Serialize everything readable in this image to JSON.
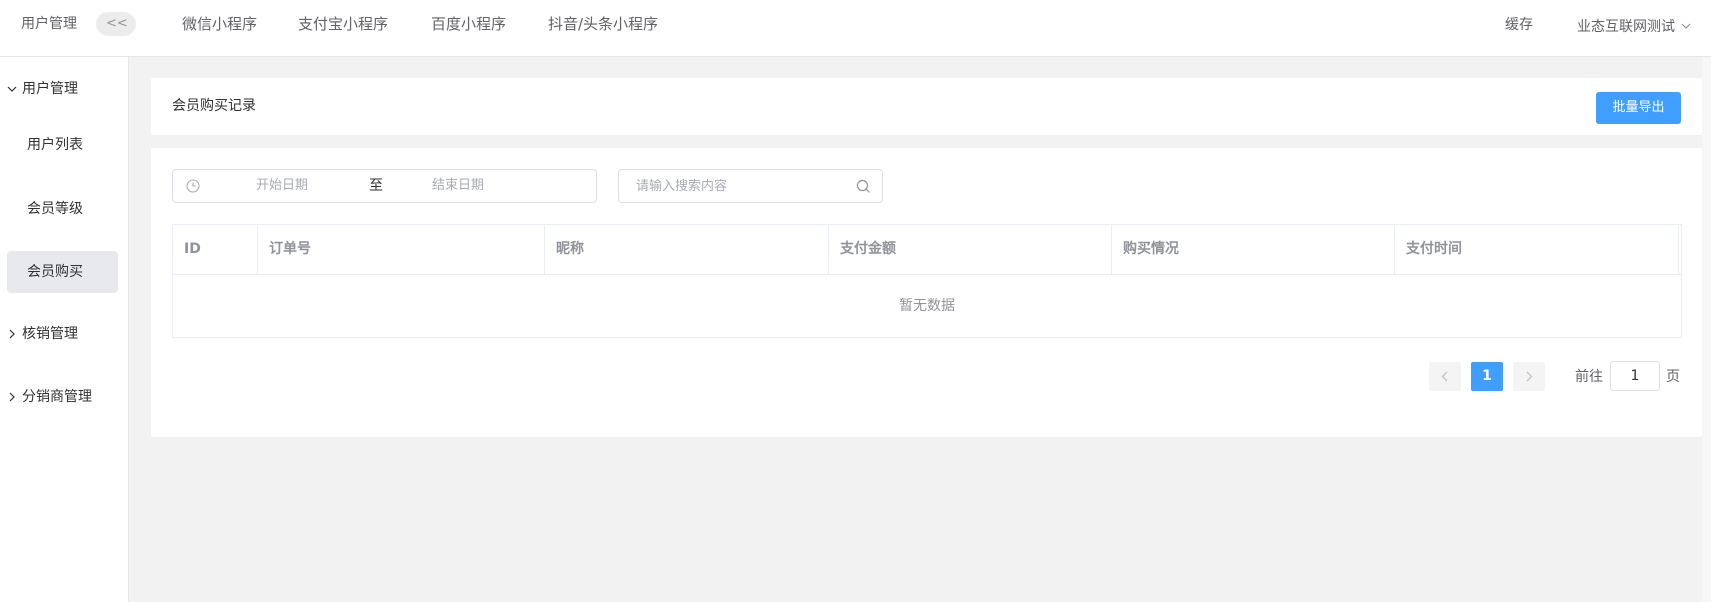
{
  "app": {
    "brand": "用户管理",
    "collapse_label": "<<"
  },
  "topnav": {
    "items": [
      "微信小程序",
      "支付宝小程序",
      "百度小程序",
      "抖音/头条小程序"
    ],
    "cache": "缓存",
    "account": "业态互联网测试",
    "account_icon": "chevron-down-icon"
  },
  "sidebar": {
    "group_user": "用户管理",
    "items": [
      "用户列表",
      "会员等级",
      "会员购买"
    ],
    "active_item": "会员购买",
    "group_verify": "核销管理",
    "group_dist": "分销商管理"
  },
  "page": {
    "title": "会员购买记录",
    "export_label": "批量导出"
  },
  "filters": {
    "start_placeholder": "开始日期",
    "range_separator": "至",
    "end_placeholder": "结束日期",
    "search_placeholder": "请输入搜索内容"
  },
  "table": {
    "columns": [
      "ID",
      "订单号",
      "昵称",
      "支付金额",
      "购买情况",
      "支付时间"
    ],
    "empty_text": "暂无数据"
  },
  "pagination": {
    "current_page": "1",
    "goto_prefix": "前往",
    "goto_value": "1",
    "goto_suffix": "页"
  },
  "colors": {
    "primary": "#409eff",
    "active_menu_bg": "#e8e9ec",
    "page_bg": "#f2f2f2"
  }
}
